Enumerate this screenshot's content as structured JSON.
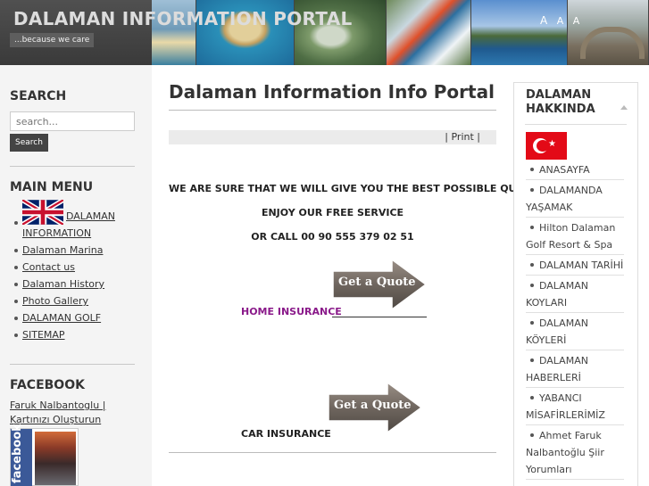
{
  "header": {
    "site_title": "DALAMAN INFORMATION PORTAL",
    "tagline": "...because we care",
    "font_controls": [
      "A",
      "A",
      "A"
    ]
  },
  "left_sidebar": {
    "search_heading": "SEARCH",
    "search_placeholder": "search...",
    "search_button": "Search",
    "main_menu_heading": "MAIN MENU",
    "menu_items": [
      "DALAMAN INFORMATION",
      "Dalaman Marina",
      "Contact us",
      "Dalaman History",
      "Photo Gallery",
      "DALAMAN GOLF",
      "SITEMAP"
    ],
    "facebook_heading": "FACEBOOK",
    "facebook_link": "Faruk Nalbantoglu | Kartınızı Oluşturun",
    "facebook_badge_text": "facebook"
  },
  "main": {
    "page_title": "Dalaman Information Info Portal",
    "print_link": "| Print |",
    "line1": "WE ARE SURE THAT WE WILL GIVE YOU THE BEST POSSIBLE QUOTE",
    "line2": "ENJOY OUR FREE SERVICE",
    "line3": "OR CALL 00 90 555 379 02 51",
    "quote_button_1": "Get a Quote",
    "quote_button_2": "Get a Quote",
    "home_insurance": "HOME INSURANCE",
    "car_insurance": "CAR INSURANCE"
  },
  "right_sidebar": {
    "heading": "DALAMAN HAKKINDA",
    "items": [
      "ANASAYFA",
      "DALAMANDA YAŞAMAK",
      "Hilton Dalaman Golf Resort & Spa",
      "DALAMAN TARİHİ",
      "DALAMAN KOYLARI",
      "DALAMAN KÖYLERİ",
      "DALAMAN HABERLERİ",
      "YABANCI MİSAFİRLERİMİZ",
      "Ahmet Faruk Nalbantoğlu Şiir Yorumları"
    ]
  },
  "colors": {
    "header_bg": "#3a3a3a",
    "home_insurance": "#8a1a8a",
    "facebook_blue": "#3b5998",
    "turkey_red": "#e30a17"
  }
}
